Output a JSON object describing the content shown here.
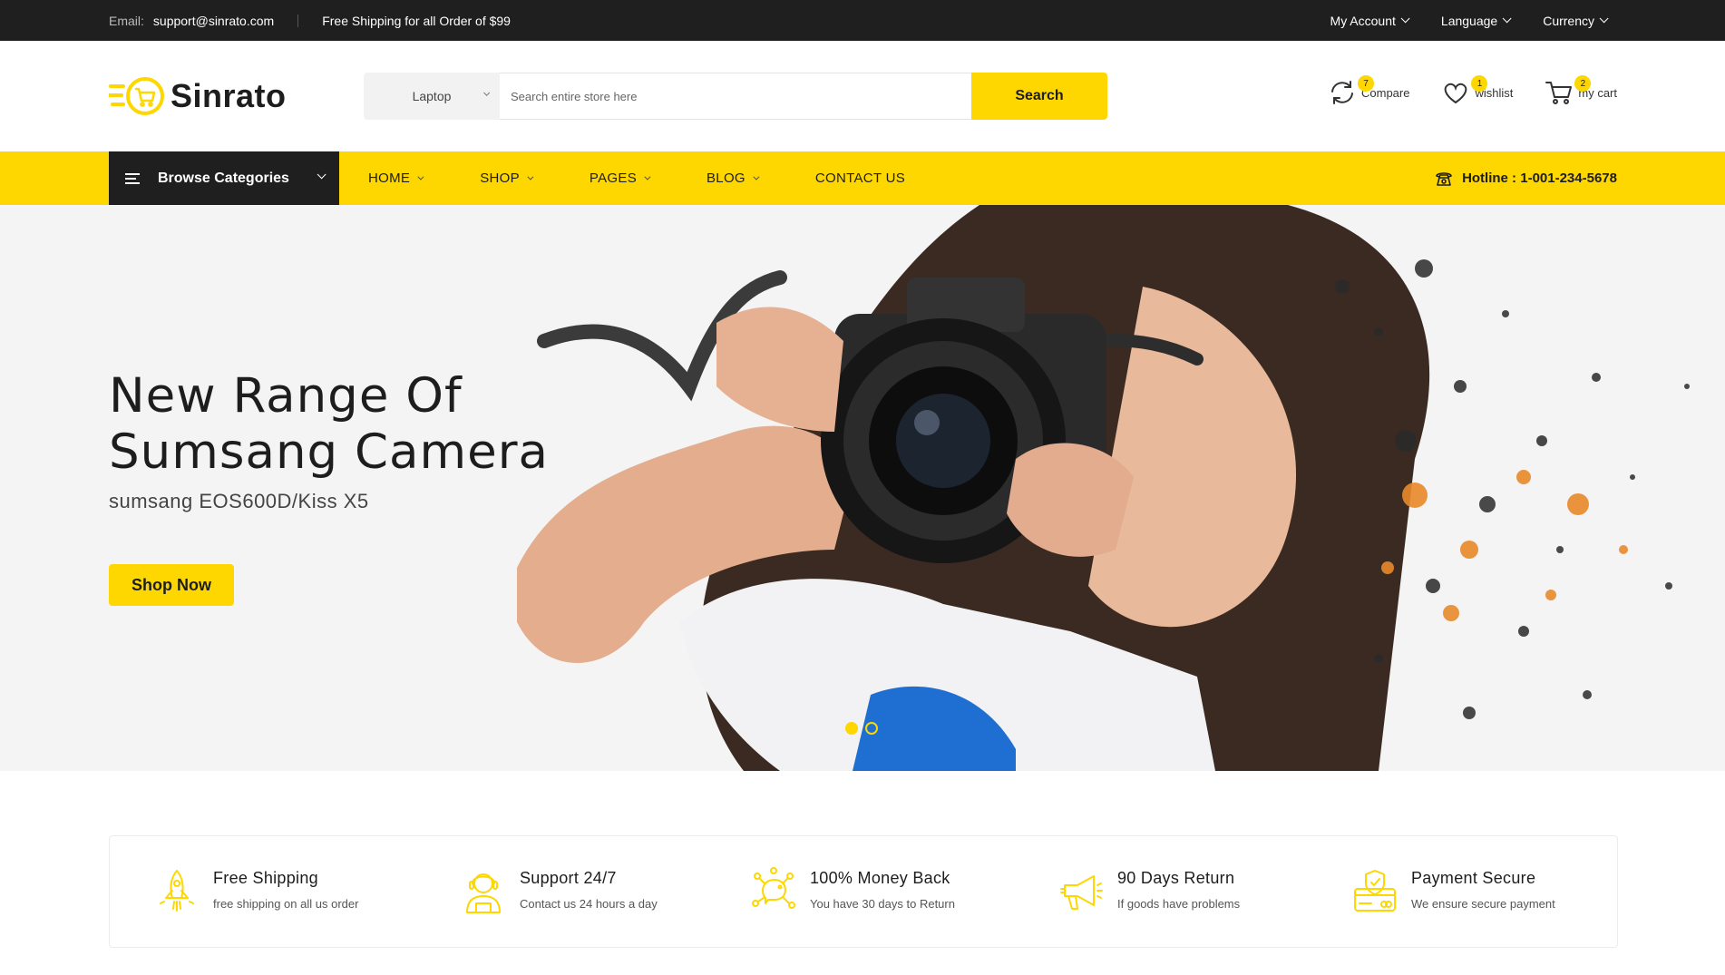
{
  "topbar": {
    "email_label": "Email:",
    "email_value": "support@sinrato.com",
    "shipping_text": "Free Shipping for all Order of $99",
    "my_account": "My Account",
    "language": "Language",
    "currency": "Currency"
  },
  "header": {
    "logo_text": "Sinrato",
    "search": {
      "category": "Laptop",
      "placeholder": "Search entire store here",
      "button": "Search"
    },
    "compare": {
      "label": "Compare",
      "count": "7"
    },
    "wishlist": {
      "label": "wishlist",
      "count": "1"
    },
    "cart": {
      "label": "my cart",
      "count": "2"
    }
  },
  "nav": {
    "browse": "Browse Categories",
    "items": [
      "HOME",
      "SHOP",
      "PAGES",
      "BLOG",
      "CONTACT US"
    ],
    "hotline_label": "Hotline :",
    "hotline_number": "1-001-234-5678"
  },
  "hero": {
    "title_line1": "New Range Of",
    "title_line2": "Sumsang Camera",
    "subtitle": "sumsang EOS600D/Kiss X5",
    "button": "Shop Now"
  },
  "features": [
    {
      "title": "Free Shipping",
      "desc": "free shipping on all us order",
      "icon": "rocket-icon"
    },
    {
      "title": "Support 24/7",
      "desc": "Contact us 24 hours a day",
      "icon": "support-agent-icon"
    },
    {
      "title": "100% Money Back",
      "desc": "You have 30 days to Return",
      "icon": "money-back-icon"
    },
    {
      "title": "90 Days Return",
      "desc": "If goods have problems",
      "icon": "megaphone-icon"
    },
    {
      "title": "Payment Secure",
      "desc": "We ensure secure payment",
      "icon": "secure-payment-icon"
    }
  ],
  "colors": {
    "accent": "#fed700",
    "dark": "#1f1f1f"
  }
}
